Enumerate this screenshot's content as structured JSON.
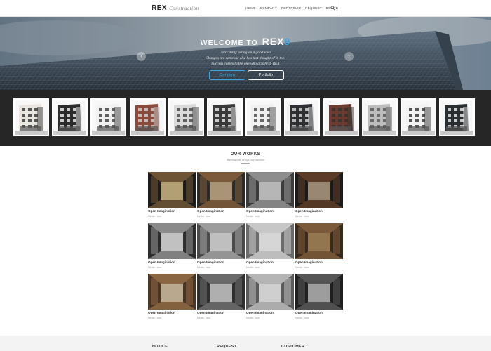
{
  "nav": {
    "logo": "REX",
    "logo_sub": "Construction",
    "menu": [
      "HOME",
      "COMPANY",
      "PORTFOLIO",
      "REQUEST",
      "BOARD"
    ]
  },
  "hero": {
    "title": "WELCOME TO",
    "brand": "REX",
    "lines": [
      "Don't delay acting on a good idea.",
      "Changes are someone else has just thought of it, too.",
      "Success comes to the one who acts first. REX"
    ],
    "btn_primary": "Company",
    "btn_secondary": "Portfolio",
    "prev": "‹",
    "next": "›"
  },
  "works": {
    "title": "OUR WORKS",
    "subtitle": "Starting with design, architecture",
    "cards": [
      {
        "title": "Open Imagination",
        "meta": "Media  ·  Icon"
      },
      {
        "title": "Open Imagination",
        "meta": "Media  ·  Icon"
      },
      {
        "title": "Open Imagination",
        "meta": "Media  ·  Icon"
      },
      {
        "title": "Open Imagination",
        "meta": "Media  ·  Icon"
      },
      {
        "title": "Open Imagination",
        "meta": "Media  ·  Icon"
      },
      {
        "title": "Open Imagination",
        "meta": "Media  ·  Icon"
      },
      {
        "title": "Open Imagination",
        "meta": "Media  ·  Icon"
      },
      {
        "title": "Open Imagination",
        "meta": "Media  ·  Icon"
      },
      {
        "title": "Open Imagination",
        "meta": "Media  ·  Icon"
      },
      {
        "title": "Open Imagination",
        "meta": "Media  ·  Icon"
      },
      {
        "title": "Open Imagination",
        "meta": "Media  ·  Icon"
      },
      {
        "title": "Open Imagination",
        "meta": "Media  ·  Icon"
      }
    ]
  },
  "footer": {
    "notice": "NOTICE",
    "request": "REQUEST",
    "customer": "CUSTOMER"
  },
  "colors": {
    "accent": "#3aa7e0",
    "strip_bg": "#262626",
    "footer_bg": "#f3f3f3"
  },
  "icons": [
    "search-icon",
    "chevron-left-icon",
    "chevron-right-icon"
  ]
}
